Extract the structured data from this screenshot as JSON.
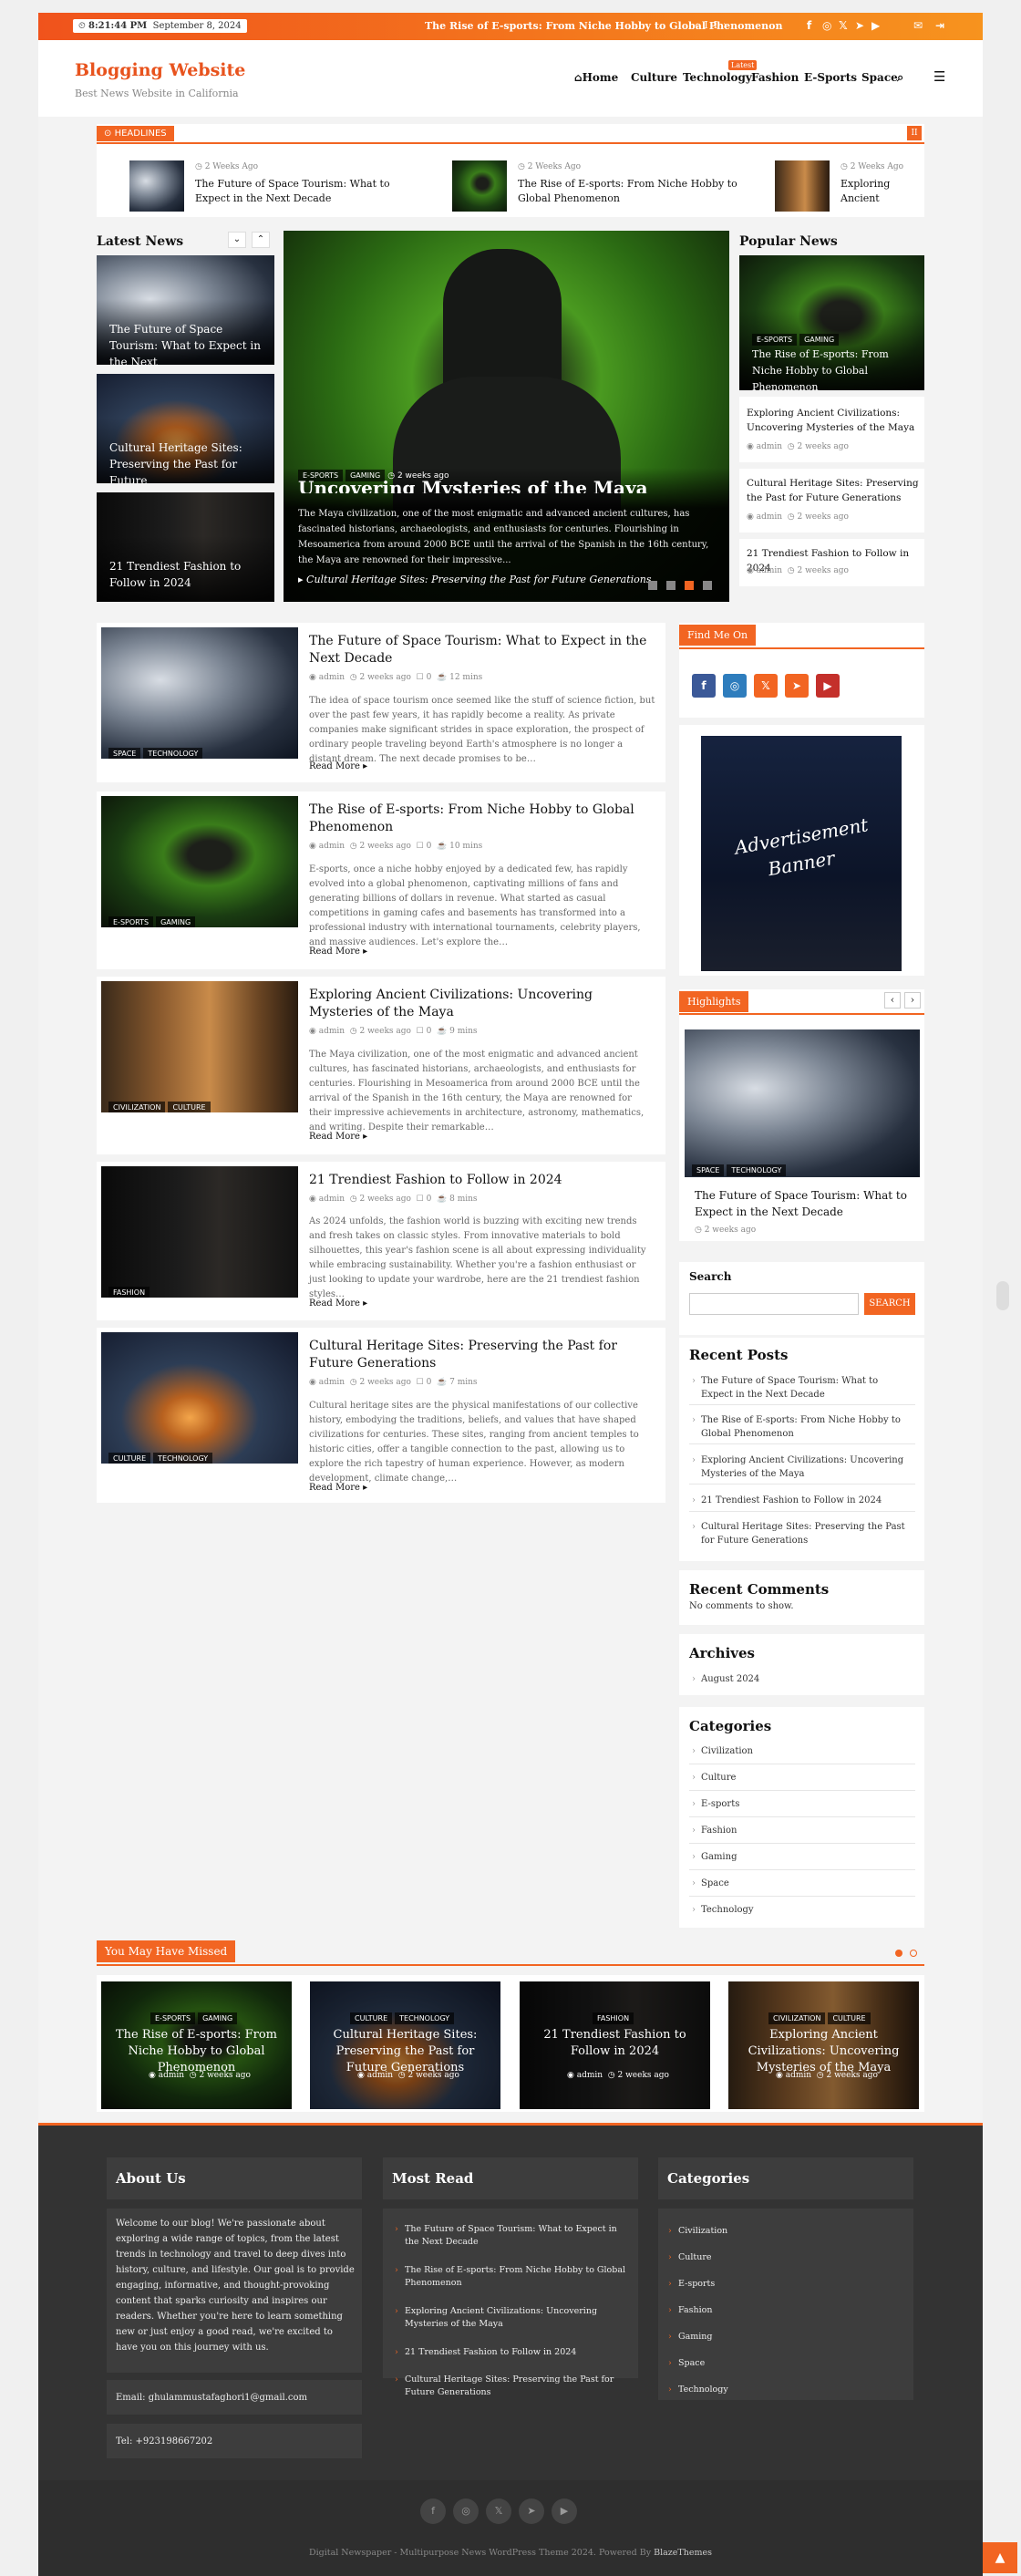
{
  "topbar": {
    "time": "8:21:44 PM",
    "date": "September 8, 2024",
    "ticker": "The Rise of E-sports: From Niche Hobby to Global Phenomenon",
    "prev": "‹",
    "pause": "II",
    "next": "›",
    "social_icons": [
      "facebook-icon",
      "instagram-icon",
      "x-icon",
      "telegram-icon",
      "youtube-icon"
    ],
    "mail_icon": "✉",
    "login_icon": "⇥"
  },
  "header": {
    "logo": "Blogging Website",
    "tagline": "Best News Website in California",
    "nav": [
      "Home",
      "Culture",
      "Technology",
      "Fashion",
      "E-Sports",
      "Space"
    ],
    "latest_badge": "Latest"
  },
  "headlines": {
    "label": "HEADLINES",
    "items": [
      {
        "date": "2 Weeks Ago",
        "title": "The Future of Space Tourism: What to Expect in the Next Decade"
      },
      {
        "date": "2 Weeks Ago",
        "title": "The Rise of E-sports: From Niche Hobby to Global Phenomenon"
      },
      {
        "date": "2 Weeks Ago",
        "title": "Exploring Ancient Civilizations: Uncovering Mysteries of the Maya"
      }
    ]
  },
  "latest_news": {
    "title": "Latest News",
    "items": [
      {
        "title": "The Future of Space Tourism: What to Expect in the Next"
      },
      {
        "title": "Cultural Heritage Sites: Preserving the Past for Future"
      },
      {
        "title": "21 Trendiest Fashion to Follow in 2024"
      }
    ]
  },
  "slider": {
    "tags": [
      "E-SPORTS",
      "GAMING"
    ],
    "date": "2 weeks ago",
    "title": "Uncovering Mysteries of the Maya",
    "text": "The Maya civilization, one of the most enigmatic and advanced ancient cultures, has fascinated historians, archaeologists, and enthusiasts for centuries. Flourishing in Mesoamerica from around 2000 BCE until the arrival of the Spanish in the 16th century, the Maya are renowned for their impressive...",
    "caption": "Cultural Heritage Sites: Preserving the Past for Future Generations"
  },
  "popular_news": {
    "title": "Popular News",
    "featured": {
      "tags": [
        "E-SPORTS",
        "GAMING"
      ],
      "title": "The Rise of E-sports: From Niche Hobby to Global Phenomenon"
    },
    "items": [
      {
        "title": "Exploring Ancient Civilizations: Uncovering Mysteries of the Maya",
        "author": "admin",
        "date": "2 weeks ago"
      },
      {
        "title": "Cultural Heritage Sites: Preserving the Past for Future Generations",
        "author": "admin",
        "date": "2 weeks ago"
      },
      {
        "title": "21 Trendiest Fashion to Follow in 2024",
        "author": "admin",
        "date": "2 weeks ago"
      }
    ]
  },
  "posts": [
    {
      "tags": [
        "SPACE",
        "TECHNOLOGY"
      ],
      "title": "The Future of Space Tourism: What to Expect in the Next Decade",
      "author": "admin",
      "date": "2 weeks ago",
      "comments": "0",
      "read": "12 mins",
      "excerpt": "The idea of space tourism once seemed like the stuff of science fiction, but over the past few years, it has rapidly become a reality. As private companies make significant strides in space exploration, the prospect of ordinary people traveling beyond Earth's atmosphere is no longer a distant dream. The next decade promises to be…",
      "more": "Read More"
    },
    {
      "tags": [
        "E-SPORTS",
        "GAMING"
      ],
      "title": "The Rise of E-sports: From Niche Hobby to Global Phenomenon",
      "author": "admin",
      "date": "2 weeks ago",
      "comments": "0",
      "read": "10 mins",
      "excerpt": "E-sports, once a niche hobby enjoyed by a dedicated few, has rapidly evolved into a global phenomenon, captivating millions of fans and generating billions of dollars in revenue. What started as casual competitions in gaming cafes and basements has transformed into a professional industry with international tournaments, celebrity players, and massive audiences. Let's explore the…",
      "more": "Read More"
    },
    {
      "tags": [
        "CIVILIZATION",
        "CULTURE"
      ],
      "title": "Exploring Ancient Civilizations: Uncovering Mysteries of the Maya",
      "author": "admin",
      "date": "2 weeks ago",
      "comments": "0",
      "read": "9 mins",
      "excerpt": "The Maya civilization, one of the most enigmatic and advanced ancient cultures, has fascinated historians, archaeologists, and enthusiasts for centuries. Flourishing in Mesoamerica from around 2000 BCE until the arrival of the Spanish in the 16th century, the Maya are renowned for their impressive achievements in architecture, astronomy, mathematics, and writing. Despite their remarkable…",
      "more": "Read More"
    },
    {
      "tags": [
        "FASHION"
      ],
      "title": "21 Trendiest Fashion to Follow in 2024",
      "author": "admin",
      "date": "2 weeks ago",
      "comments": "0",
      "read": "8 mins",
      "excerpt": "As 2024 unfolds, the fashion world is buzzing with exciting new trends and fresh takes on classic styles. From innovative materials to bold silhouettes, this year's fashion scene is all about expressing individuality while embracing sustainability. Whether you're a fashion enthusiast or just looking to update your wardrobe, here are the 21 trendiest fashion styles…",
      "more": "Read More"
    },
    {
      "tags": [
        "CULTURE",
        "TECHNOLOGY"
      ],
      "title": "Cultural Heritage Sites: Preserving the Past for Future Generations",
      "author": "admin",
      "date": "2 weeks ago",
      "comments": "0",
      "read": "7 mins",
      "excerpt": "Cultural heritage sites are the physical manifestations of our collective history, embodying the traditions, beliefs, and values that have shaped civilizations for centuries. These sites, ranging from ancient temples to historic cities, offer a tangible connection to the past, allowing us to explore the rich tapestry of human experience. However, as modern development, climate change,…",
      "more": "Read More"
    }
  ],
  "sidebar": {
    "find_us": "Find Me On",
    "ad_line1": "Advertisement",
    "ad_line2": "Banner",
    "highlights": {
      "label": "Highlights",
      "tags": [
        "SPACE",
        "TECHNOLOGY"
      ],
      "title": "The Future of Space Tourism: What to Expect in the Next Decade",
      "date": "2 weeks ago"
    },
    "search": {
      "title": "Search",
      "placeholder": "",
      "button": "SEARCH"
    },
    "recent_posts": {
      "title": "Recent Posts",
      "items": [
        "The Future of Space Tourism: What to Expect in the Next Decade",
        "The Rise of E-sports: From Niche Hobby to Global Phenomenon",
        "Exploring Ancient Civilizations: Uncovering Mysteries of the Maya",
        "21 Trendiest Fashion to Follow in 2024",
        "Cultural Heritage Sites: Preserving the Past for Future Generations"
      ]
    },
    "recent_comments": {
      "title": "Recent Comments",
      "text": "No comments to show."
    },
    "archives": {
      "title": "Archives",
      "items": [
        "August 2024"
      ]
    },
    "categories": {
      "title": "Categories",
      "items": [
        "Civilization",
        "Culture",
        "E-sports",
        "Fashion",
        "Gaming",
        "Space",
        "Technology"
      ]
    }
  },
  "missed": {
    "title": "You May Have Missed",
    "items": [
      {
        "tags": [
          "E-SPORTS",
          "GAMING"
        ],
        "title": "The Rise of E-sports: From Niche Hobby to Global Phenomenon",
        "author": "admin",
        "date": "2 weeks ago"
      },
      {
        "tags": [
          "CULTURE",
          "TECHNOLOGY"
        ],
        "title": "Cultural Heritage Sites: Preserving the Past for Future Generations",
        "author": "admin",
        "date": "2 weeks ago"
      },
      {
        "tags": [
          "FASHION"
        ],
        "title": "21 Trendiest Fashion to Follow in 2024",
        "author": "admin",
        "date": "2 weeks ago"
      },
      {
        "tags": [
          "CIVILIZATION",
          "CULTURE"
        ],
        "title": "Exploring Ancient Civilizations: Uncovering Mysteries of the Maya",
        "author": "admin",
        "date": "2 weeks ago"
      }
    ]
  },
  "footer": {
    "about_title": "About Us",
    "about_text": "Welcome to our blog! We're passionate about exploring a wide range of topics, from the latest trends in technology and travel to deep dives into history, culture, and lifestyle. Our goal is to provide engaging, informative, and thought-provoking content that sparks curiosity and inspires our readers. Whether you're here to learn something new or just enjoy a good read, we're excited to have you on this journey with us.",
    "email": "Email: ghulammustafaghori1@gmail.com",
    "tel": "Tel: +923198667202",
    "most_read_title": "Most Read",
    "most_read": [
      "The Future of Space Tourism: What to Expect in the Next Decade",
      "The Rise of E-sports: From Niche Hobby to Global Phenomenon",
      "Exploring Ancient Civilizations: Uncovering Mysteries of the Maya",
      "21 Trendiest Fashion to Follow in 2024",
      "Cultural Heritage Sites: Preserving the Past for Future Generations"
    ],
    "categories_title": "Categories",
    "categories": [
      "Civilization",
      "Culture",
      "E-sports",
      "Fashion",
      "Gaming",
      "Space",
      "Technology"
    ],
    "copyright": "Digital Newspaper - Multipurpose News WordPress Theme 2024. Powered By ",
    "copyright_link": "BlazeThemes"
  },
  "colors": {
    "accent": "#f26522",
    "footer_bg": "#333333"
  }
}
